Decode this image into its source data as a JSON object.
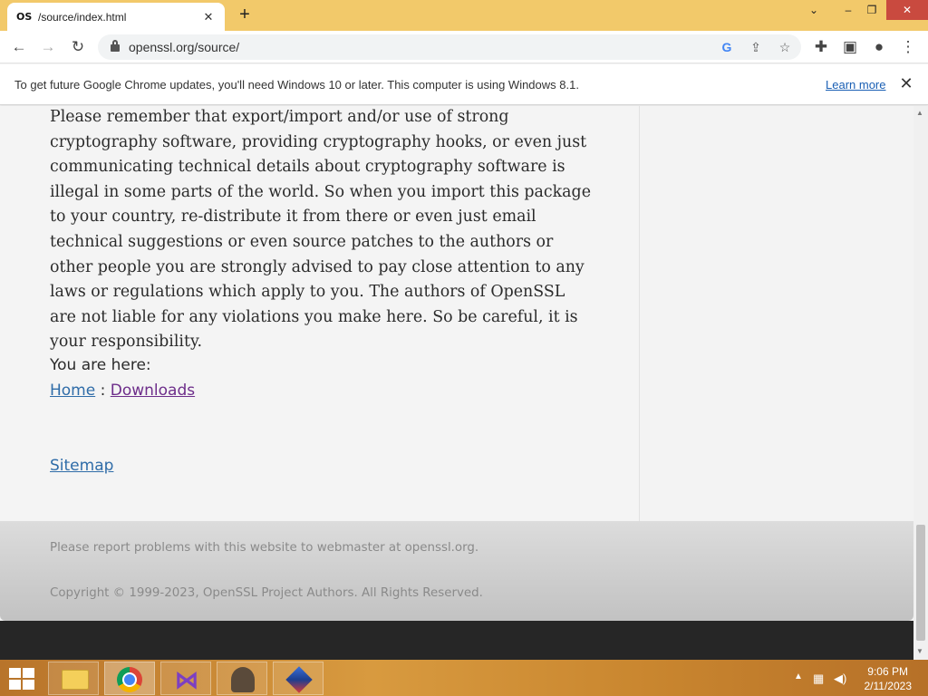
{
  "browser": {
    "tab": {
      "favicon": "OS",
      "title": "/source/index.html",
      "close": "✕"
    },
    "new_tab": "+",
    "window_controls": {
      "dropdown": "⌄",
      "minimize": "–",
      "restore": "❐",
      "close": "✕"
    },
    "url": "openssl.org/source/"
  },
  "infobar": {
    "message": "To get future Google Chrome updates, you'll need Windows 10 or later. This computer is using Windows 8.1.",
    "link": "Learn more",
    "close": "✕"
  },
  "page": {
    "paragraph": "Please remember that export/import and/or use of strong cryptography software, providing cryptography hooks, or even just communicating technical details about cryptography software is illegal in some parts of the world. So when you import this package to your country, re-distribute it from there or even just email technical suggestions or even source patches to the authors or other people you are strongly advised to pay close attention to any laws or regulations which apply to you. The authors of OpenSSL are not liable for any violations you make here. So be careful, it is your responsibility.",
    "you_are_here": "You are here:",
    "breadcrumb": {
      "home": "Home",
      "separator": " : ",
      "downloads": "Downloads"
    },
    "sitemap": "Sitemap",
    "footer": {
      "report": "Please report problems with this website to webmaster at openssl.org.",
      "copyright": "Copyright © 1999-2023, OpenSSL Project Authors. All Rights Reserved."
    }
  },
  "taskbar": {
    "time": "9:06 PM",
    "date": "2/11/2023",
    "apps": [
      "file-explorer",
      "chrome",
      "visual-studio",
      "app-user",
      "cube-app"
    ]
  },
  "colors": {
    "tabstrip": "#f2c96a",
    "link": "#2f6ca8",
    "visited_link": "#6d2d8a",
    "footer_text": "#8a8a8a",
    "window_close": "#c94a3f"
  }
}
